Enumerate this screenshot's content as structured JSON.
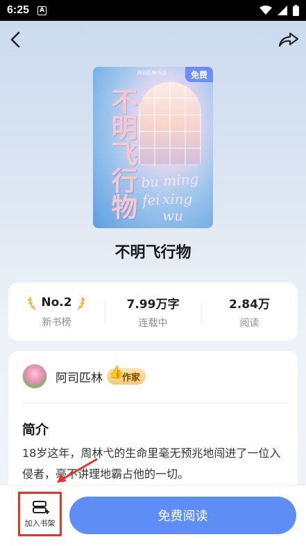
{
  "status_bar": {
    "time": "6:25",
    "indicator": "A"
  },
  "nav": {
    "back_icon": "chevron-left-icon",
    "share_icon": "share-icon"
  },
  "cover": {
    "badge": "免费",
    "top_text": "阿司匹林作品",
    "title_art": "不明飞行物",
    "script_line_1": "bu ming fei",
    "script_line_2": "xing wu"
  },
  "book": {
    "title": "不明飞行物"
  },
  "stats": [
    {
      "value": "No.2",
      "label": "新书榜"
    },
    {
      "value": "7.99万字",
      "label": "连载中"
    },
    {
      "value": "2.84万",
      "label": "阅读"
    }
  ],
  "author": {
    "name": "阿司匹林",
    "tag": "作家"
  },
  "intro": {
    "heading": "简介",
    "text": "18岁这年，周林弋的生命里毫无预兆地闯进了一位入侵者，毫不讲理地霸占他的一切。"
  },
  "bottom": {
    "shelf_label": "加入书架",
    "read_label": "免费阅读"
  },
  "colors": {
    "accent": "#5e8df6",
    "highlight": "#e4352d",
    "tag_gold": "#f0c978"
  }
}
